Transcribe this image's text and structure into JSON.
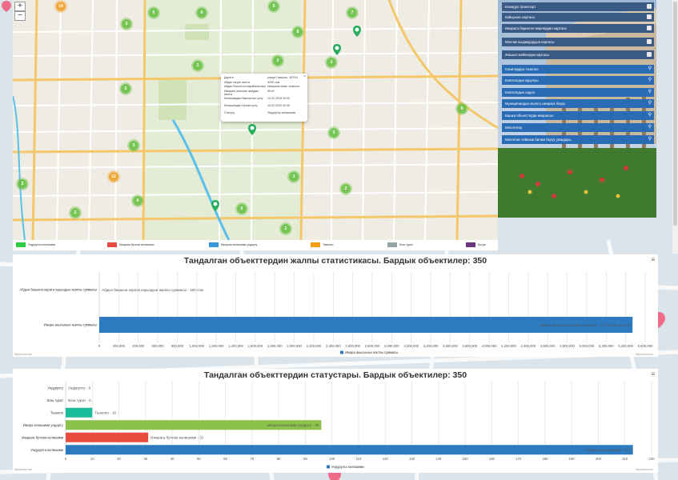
{
  "map": {
    "zoom_in": "+",
    "zoom_out": "−",
    "clusters": [
      {
        "label": "14",
        "color": "o"
      },
      {
        "label": "3",
        "color": "g"
      },
      {
        "label": "6",
        "color": "g"
      },
      {
        "label": "6",
        "color": "g"
      },
      {
        "label": "5",
        "color": "g"
      },
      {
        "label": "7",
        "color": "g"
      },
      {
        "label": "8",
        "color": "g"
      },
      {
        "label": "2",
        "color": "g"
      },
      {
        "label": "2",
        "color": "g"
      },
      {
        "label": "3",
        "color": "g"
      },
      {
        "label": "5",
        "color": "g"
      },
      {
        "label": "6",
        "color": "g"
      },
      {
        "label": "3",
        "color": "g"
      },
      {
        "label": "12",
        "color": "o"
      },
      {
        "label": "2",
        "color": "g"
      },
      {
        "label": "6",
        "color": "g"
      },
      {
        "label": "3",
        "color": "g"
      },
      {
        "label": "2",
        "color": "g"
      },
      {
        "label": "2",
        "color": "g"
      },
      {
        "label": "5",
        "color": "g"
      },
      {
        "label": "2",
        "color": "g"
      },
      {
        "label": "2",
        "color": "g"
      },
      {
        "label": "3",
        "color": "g"
      }
    ],
    "popup": {
      "rows": [
        {
          "k": "Дареги",
          "v": "улица Горького, 187/44"
        },
        {
          "k": "Абдан жерге аянты",
          "v": "4200 сом"
        },
        {
          "k": "Абдан бошонгон карабагытасы",
          "v": "Ижарачы кызм. аныктоо"
        },
        {
          "k": "Ижарага алынган жайдын аянты",
          "v": "55 м²"
        },
        {
          "k": "Келишимдин башталган күнү",
          "v": "14.02.2018 00:00"
        },
        {
          "k": "Келишимдин бүткөн күнү",
          "v": "14.02.2022 00:00"
        },
        {
          "k": "Статусу",
          "v": "Ундурулгу келишимы"
        }
      ]
    },
    "legend": [
      {
        "label": "Ундурулга келишими",
        "color": "#2ecc40"
      },
      {
        "label": "Ижарага бутком келишими",
        "color": "#e74c3c"
      },
      {
        "label": "Ижарага келишими ундарту",
        "color": "#3498db"
      },
      {
        "label": "Тазалоо",
        "color": "#f39c12"
      },
      {
        "label": "Бош турат",
        "color": "#95a5a6"
      },
      {
        "label": "Бутум",
        "color": "#6c3483"
      }
    ]
  },
  "panel": {
    "layers": [
      "Коомдук транспорт",
      "Кайырыкс картасы",
      "Ижарага берилген жерлердин картасы",
      "Менчик кыдамдардын картасы",
      "Жашыл мейкиндик картасы"
    ],
    "categories": [
      "Санитардык тазалоо",
      "Капиталдык курулуш",
      "Капиталдык оңдоо",
      "Муниципалдык мүлкту ижарага берүү",
      "Башка объекттерди ижаралоо",
      "Мектептер",
      "Мектепке чейинки билим берүү уюмдары"
    ],
    "layer_color": "#3a5a86",
    "category_color": "#2a6bb5"
  },
  "chart_data": [
    {
      "type": "bar",
      "orientation": "horizontal",
      "title": "Тандалган объекттердин жалпы статистикасы. Бардык объектилер: 350",
      "categories": [
        "Абдын башына карата карыздын жалпы суммасы",
        "Ижара акысынын жалпы суммасы"
      ],
      "values": [
        100,
        5470304.38
      ],
      "data_labels": [
        "Абдын башына карата карыздын жалпы суммасы - 100 сом",
        "Ижара акысынын жалпы суммасы - 5 470 304.38 сом"
      ],
      "xlim": [
        0,
        5600000
      ],
      "xticks": [
        "0",
        "200,000",
        "400,000",
        "600,000",
        "800,000",
        "1,000,000",
        "1,200,000",
        "1,400,000",
        "1,600,000",
        "1,800,000",
        "2,000,000",
        "2,200,000",
        "2,400,000",
        "2,600,000",
        "2,800,000",
        "3,000,000",
        "3,200,000",
        "3,400,000",
        "3,600,000",
        "3,800,000",
        "4,000,000",
        "4,200,000",
        "4,400,000",
        "4,600,000",
        "4,800,000",
        "5,000,000",
        "5,200,000",
        "5,400,000",
        "5,600,000"
      ],
      "legend": "Ижара акысынын жалпы суммасы",
      "colors": [
        "#2d7ac0",
        "#2d7ac0"
      ],
      "grid": true,
      "credit": "Highcharts.com"
    },
    {
      "type": "bar",
      "orientation": "horizontal",
      "title": "Тандалган объекттердин статустары. Бардык объектилер: 350",
      "categories": [
        "Ундурулгу",
        "Бош турат",
        "Тазалоо",
        "Ижара келишими ундарту",
        "Ижарага бутком келишими",
        "Ундурулга келишими"
      ],
      "values": [
        0,
        0,
        10,
        96,
        31,
        213
      ],
      "data_labels": [
        "Ундурулгу - 0",
        "Бош турат - 0",
        "Тазалоо - 10",
        "Ижара келишими ундарту - 96",
        "Ижарага бутком келишими - 31",
        "Ундурулга келишими - 213"
      ],
      "colors": [
        "#2d7ac0",
        "#2d7ac0",
        "#1abc9c",
        "#8bc34a",
        "#e74c3c",
        "#2d7ac0"
      ],
      "xlim": [
        0,
        220
      ],
      "xticks": [
        "0",
        "10",
        "20",
        "30",
        "40",
        "50",
        "60",
        "70",
        "80",
        "90",
        "100",
        "110",
        "120",
        "130",
        "140",
        "150",
        "160",
        "170",
        "180",
        "190",
        "200",
        "210",
        "220"
      ],
      "legend": "Ундурулга келишими",
      "grid": true,
      "credit": "Highcharts.com"
    }
  ]
}
